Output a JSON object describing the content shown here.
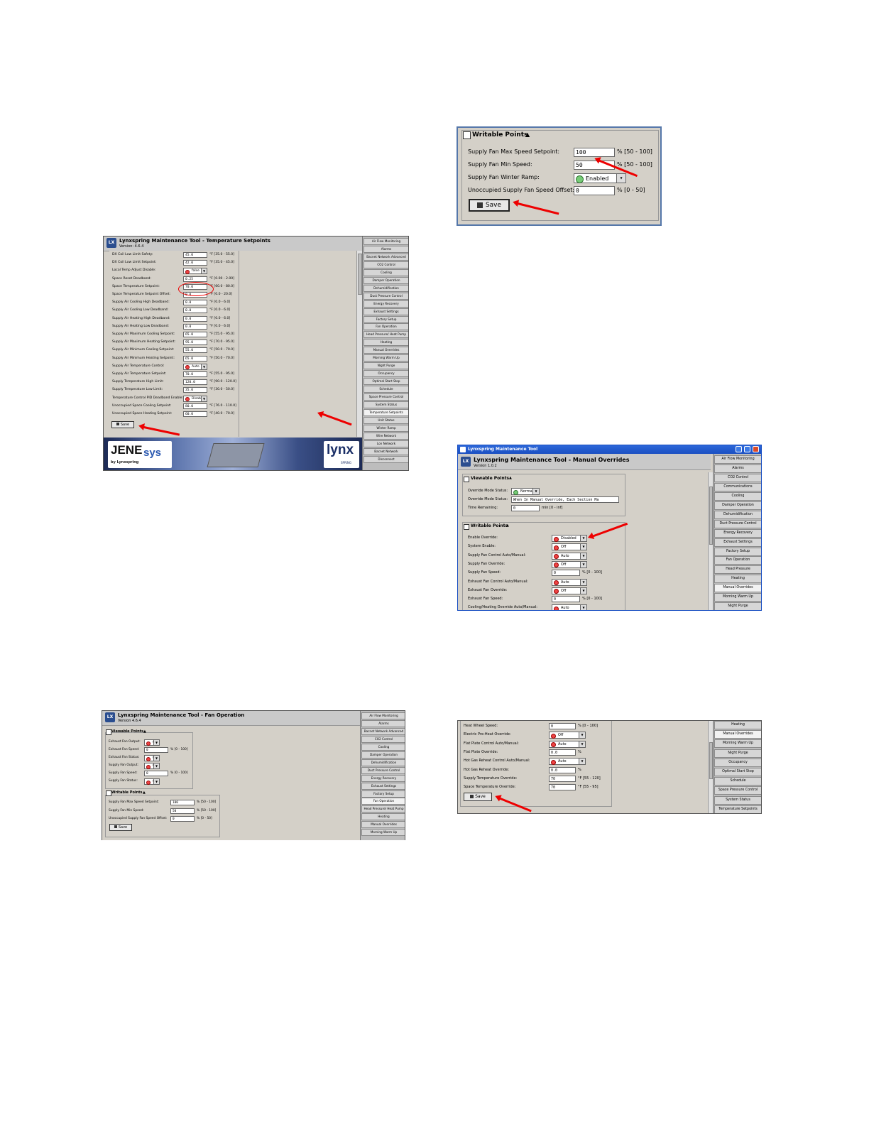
{
  "screen1": {
    "title": "Lynxspring Maintenance Tool - Temperature Setpoints",
    "version": "Version: 4.6.4",
    "rows": [
      {
        "label": "DX Coil Low Limit Safety:",
        "value": "45.0",
        "unit": "°F [35.0 - 55.0]"
      },
      {
        "label": "DX Coil Low Limit Setpoint:",
        "value": "42.0",
        "unit": "°F [35.0 - 45.0]"
      },
      {
        "label": "Local Temp Adjust Disable:",
        "dropdown": "false"
      },
      {
        "label": "Space Reset Deadband:",
        "value": "0.25",
        "unit": "°F [0.00 - 2.00]"
      },
      {
        "label": "Space Temperature Setpoint:",
        "value": "70.0",
        "unit": "°F [60.0 - 80.0]"
      },
      {
        "label": "Space Temperature Setpoint Offset:",
        "value": "0.0",
        "unit": "°F [0.0 - 20.0]"
      },
      {
        "label": "Supply Air Cooling High Deadband:",
        "value": "0.0",
        "unit": "°F [0.0 - 6.0]"
      },
      {
        "label": "Supply Air Cooling Low Deadband:",
        "value": "0.0",
        "unit": "°F [0.0 - 6.0]"
      },
      {
        "label": "Supply Air Heating High Deadband:",
        "value": "0.0",
        "unit": "°F [0.0 - 6.0]"
      },
      {
        "label": "Supply Air Heating Low Deadband:",
        "value": "0.0",
        "unit": "°F [0.0 - 6.0]"
      },
      {
        "label": "Supply Air Maximum Cooling Setpoint:",
        "value": "65.0",
        "unit": "°F [55.0 - 95.0]"
      },
      {
        "label": "Supply Air Maximum Heating Setpoint:",
        "value": "95.0",
        "unit": "°F [70.0 - 95.0]"
      },
      {
        "label": "Supply Air Minimum Cooling Setpoint:",
        "value": "55.0",
        "unit": "°F [50.0 - 70.0]"
      },
      {
        "label": "Supply Air Minimum Heating Setpoint:",
        "value": "65.0",
        "unit": "°F [50.0 - 70.0]"
      },
      {
        "label": "Supply Air Temperature Control:",
        "dropdown": "Auto"
      },
      {
        "label": "Supply Air Temperature Setpoint:",
        "value": "70.0",
        "unit": "°F [55.0 - 95.0]"
      },
      {
        "label": "Supply Temperature High Limit:",
        "value": "120.0",
        "unit": "°F [90.0 - 120.0]"
      },
      {
        "label": "Supply Temperature Low Limit:",
        "value": "35.0",
        "unit": "°F [30.0 - 50.0]"
      },
      {
        "label": "Temperature Control PID Deadband Enable:",
        "dropdown": "Disable"
      },
      {
        "label": "Unoccupied Space Cooling Setpoint:",
        "value": "80.0",
        "unit": "°F [76.0 - 110.0]"
      },
      {
        "label": "Unoccupied Space Heating Setpoint:",
        "value": "60.0",
        "unit": "°F [40.0 - 70.0]"
      }
    ],
    "save_label": "Save",
    "nav": [
      "Air Flow Monitoring",
      "Alarms",
      "Bacnet Network Advanced",
      "CO2 Control",
      "Cooling",
      "Damper Operation",
      "Dehumidification",
      "Duct Pressure Control",
      "Energy Recovery",
      "Exhaust Settings",
      "Factory Setup",
      "Fan Operation",
      "Head Pressure/ Heat Pump",
      "Heating",
      "Manual Overrides",
      "Morning Warm Up",
      "Night Purge",
      "Occupancy",
      "Optimal Start Stop",
      "Schedule",
      "Space Pressure Control",
      "System Status",
      "Temperature Setpoints",
      "Unit Status",
      "Winter Ramp",
      "Wire Network",
      "Lon Network",
      "Bacnet Network",
      "Disconnect"
    ],
    "selected_nav": "Temperature Setpoints",
    "footer_brand": "JENE",
    "footer_brand2": "sys",
    "footer_by": "by Lynxspring",
    "footer_logo": "lynx",
    "footer_logo_sub": "SPRING"
  },
  "screen2": {
    "section": "Writable Points",
    "rows": [
      {
        "label": "Supply Fan Max Speed Setpoint:",
        "value": "100",
        "unit": "% [50 - 100]"
      },
      {
        "label": "Supply Fan Min Speed:",
        "value": "50",
        "unit": "% [50 - 100]"
      },
      {
        "label": "Supply Fan Winter Ramp:",
        "dropdown": "Enabled"
      },
      {
        "label": "Unoccupied Supply Fan Speed Offset:",
        "value": "0",
        "unit": "% [0 - 50]"
      }
    ],
    "save_label": "Save"
  },
  "screen3": {
    "window_title": "Lynxspring Maintenance Tool",
    "title": "Lynxspring Maintenance Tool - Manual Overrides",
    "version": "Version 1.0.2",
    "viewable_section": "Viewable Points",
    "viewable": [
      {
        "label": "Override Mode Status:",
        "dropdown": "Normal"
      },
      {
        "label": "Override Mode Status:",
        "text": "When In Manual Override, Each Section Ma"
      },
      {
        "label": "Time Remaining:",
        "value": "0",
        "unit": "min [0 - inf]"
      }
    ],
    "writable_section": "Writable Points",
    "writable": [
      {
        "label": "Enable Override:",
        "dropdown": "Disabled"
      },
      {
        "label": "System Enable:",
        "dropdown": "Off"
      },
      {
        "label": "Supply Fan Control Auto/Manual:",
        "dropdown": "Auto"
      },
      {
        "label": "Supply Fan Override:",
        "dropdown": "Off"
      },
      {
        "label": "Supply Fan Speed:",
        "value": "0",
        "unit": "% [0 - 100]"
      },
      {
        "label": "Exhaust Fan Control Auto/Manual:",
        "dropdown": "Auto"
      },
      {
        "label": "Exhaust Fan Override:",
        "dropdown": "Off"
      },
      {
        "label": "Exhaust Fan Speed:",
        "value": "0",
        "unit": "% [0 - 100]"
      },
      {
        "label": "Cooling/Heating Override Auto/Manual:",
        "dropdown": "Auto"
      }
    ],
    "nav": [
      "Air Flow Monitoring",
      "Alarms",
      "CO2 Control",
      "Communications",
      "Cooling",
      "Damper Operation",
      "Dehumidification",
      "Duct Pressure Control",
      "Energy Recovery",
      "Exhaust Settings",
      "Factory Setup",
      "Fan Operation",
      "Head Pressure",
      "Heating",
      "Manual Overrides",
      "Morning Warm Up",
      "Night Purge"
    ],
    "selected_nav": "Manual Overrides"
  },
  "screen4": {
    "title": "Lynxspring Maintenance Tool - Fan Operation",
    "version": "Version 4.6.4",
    "viewable_section": "Viewable Points",
    "viewable": [
      {
        "label": "Exhaust Fan Output:",
        "dropdown": "Off"
      },
      {
        "label": "Exhaust Fan Speed:",
        "value": "0",
        "unit": "% [0 - 100]"
      },
      {
        "label": "Exhaust Fan Status:",
        "dropdown": "Off"
      },
      {
        "label": "Supply Fan Output:",
        "dropdown": "Off"
      },
      {
        "label": "Supply Fan Speed:",
        "value": "0",
        "unit": "% [0 - 100]"
      },
      {
        "label": "Supply Fan Status:",
        "dropdown": "Off"
      }
    ],
    "writable_section": "Writable Points",
    "writable": [
      {
        "label": "Supply Fan Max Speed Setpoint:",
        "value": "100",
        "unit": "% [50 - 100]"
      },
      {
        "label": "Supply Fan Min Speed:",
        "value": "50",
        "unit": "% [50 - 100]"
      },
      {
        "label": "Unoccupied Supply Fan Speed Offset:",
        "value": "0",
        "unit": "% [0 - 50]"
      }
    ],
    "save_label": "Save",
    "nav": [
      "Air Flow Monitoring",
      "Alarms",
      "Bacnet Network Advanced",
      "CO2 Control",
      "Cooling",
      "Damper Operation",
      "Dehumidification",
      "Duct Pressure Control",
      "Energy Recovery",
      "Exhaust Settings",
      "Factory Setup",
      "Fan Operation",
      "Head Pressure/ Heat Pump",
      "Heating",
      "Manual Overrides",
      "Morning Warm Up"
    ],
    "selected_nav": "Fan Operation"
  },
  "screen5": {
    "rows": [
      {
        "label": "Heat Wheel Speed:",
        "value": "0",
        "unit": "% [0 - 100]"
      },
      {
        "label": "Electric Pre-Heat Override:",
        "dropdown": "Off"
      },
      {
        "label": "Flat Plate Control Auto/Manual:",
        "dropdown": "Auto"
      },
      {
        "label": "Flat Plate Override:",
        "value": "0.0",
        "unit": "%"
      },
      {
        "label": "Hot Gas Reheat Control Auto/Manual:",
        "dropdown": "Auto"
      },
      {
        "label": "Hot Gas Reheat Override:",
        "value": "0.0",
        "unit": "%"
      },
      {
        "label": "Supply Temperature Override:",
        "value": "70",
        "unit": "°F [55 - 120]"
      },
      {
        "label": "Space Temperature Override:",
        "value": "70",
        "unit": "°F [55 - 95]"
      }
    ],
    "save_label": "Save",
    "nav": [
      "Heating",
      "Manual Overrides",
      "Morning Warm Up",
      "Night Purge",
      "Occupancy",
      "Optimal Start Stop",
      "Schedule",
      "Space Pressure Control",
      "System Status",
      "Temperature Setpoints"
    ],
    "selected_nav": "Manual Overrides"
  },
  "colors": {
    "annotation": "#e00000",
    "panel": "#d4d0c8",
    "xp_title": "#1a4fc2"
  }
}
